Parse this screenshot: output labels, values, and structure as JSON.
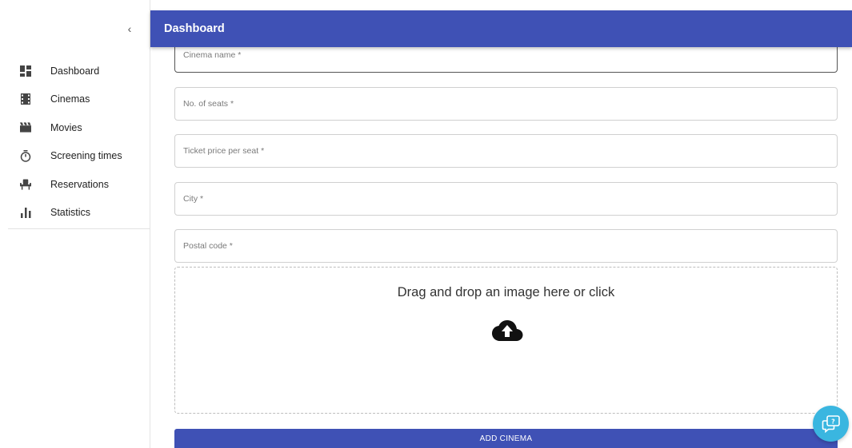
{
  "header": {
    "title": "Dashboard"
  },
  "sidebar": {
    "collapse_glyph": "‹",
    "items": [
      {
        "label": "Dashboard",
        "icon": "dashboard-icon"
      },
      {
        "label": "Cinemas",
        "icon": "film-strip-icon"
      },
      {
        "label": "Movies",
        "icon": "clapperboard-icon"
      },
      {
        "label": "Screening times",
        "icon": "stopwatch-icon"
      },
      {
        "label": "Reservations",
        "icon": "seat-icon"
      },
      {
        "label": "Statistics",
        "icon": "bar-chart-icon"
      }
    ]
  },
  "form": {
    "fields": [
      {
        "label": "Cinema name *"
      },
      {
        "label": "No. of seats *"
      },
      {
        "label": "Ticket price per seat *"
      },
      {
        "label": "City *"
      },
      {
        "label": "Postal code *"
      }
    ],
    "dropzone_text": "Drag and drop an image here or click",
    "submit_label": "ADD CINEMA"
  },
  "colors": {
    "primary": "#3f51b5",
    "help_fab": "#3ab6e0"
  }
}
